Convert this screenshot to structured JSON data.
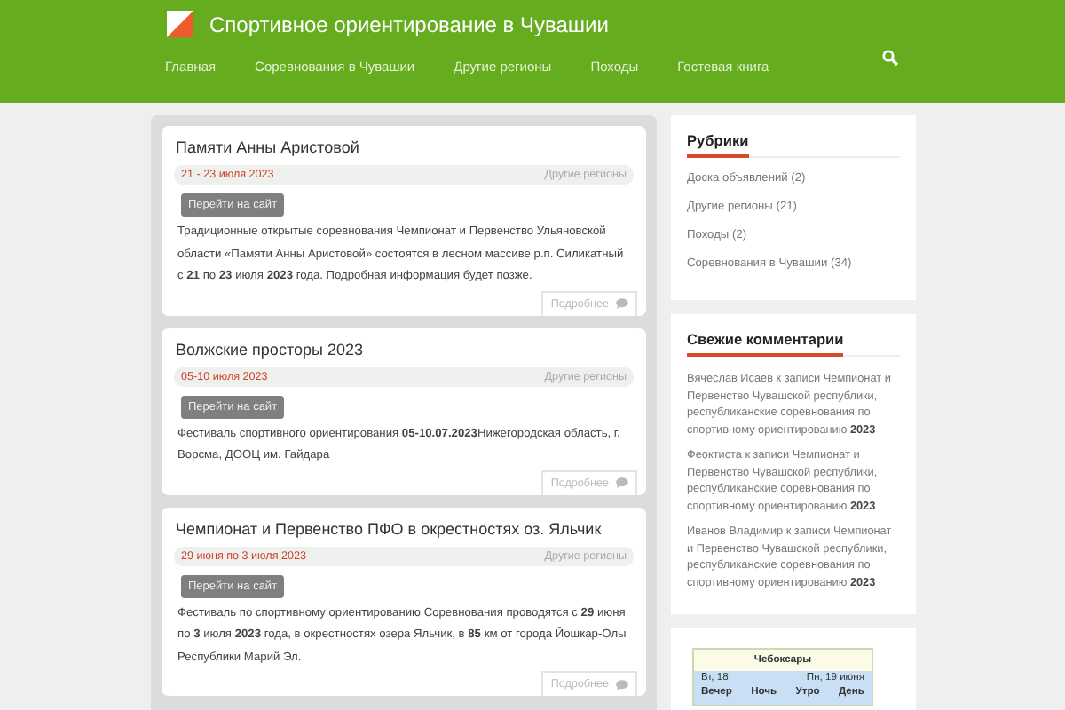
{
  "site": {
    "title": "Спортивное ориентирование в Чувашии"
  },
  "nav": [
    {
      "label": "Главная"
    },
    {
      "label": "Соревнования в Чувашии"
    },
    {
      "label": "Другие регионы"
    },
    {
      "label": "Походы"
    },
    {
      "label": "Гостевая книга"
    }
  ],
  "posts": [
    {
      "title": "Памяти Анны Аристовой",
      "date": "21 - 23 июля 2023",
      "category": "Другие регионы",
      "button": "Перейти на сайт",
      "text": "Традиционные открытые соревнования Чемпионат и Первенство Ульяновской области «Памяти Анны Аристовой» состоятся в лесном массиве р.п. Силикатный с **21** по **23** июля **2023** года. Подробная информация будет позже.",
      "more": "Подробнее"
    },
    {
      "title": "Волжские просторы 2023",
      "date": "05-10 июля 2023",
      "category": "Другие регионы",
      "button": "Перейти на сайт",
      "text": "Фестиваль спортивного ориентирования **05-10.07.2023**Нижегородская область, г. Ворсма, ДООЦ им. Гайдара",
      "more": "Подробнее"
    },
    {
      "title": "Чемпионат и Первенство ПФО в окрестностях оз. Яльчик",
      "date": "29 июня по 3 июля 2023",
      "category": "Другие регионы",
      "button": "Перейти на сайт",
      "text": "Фестиваль по спортивному ориентированию Соревнования проводятся с **29** июня по **3** июля **2023** года, в окрестностях озера Яльчик, в **85** км от города Йошкар-Олы Республики Марий Эл.",
      "more": "Подробнее"
    }
  ],
  "sidebar": {
    "categories": {
      "title": "Рубрики",
      "items": [
        {
          "label": "Доска объявлений",
          "count": "(2)"
        },
        {
          "label": "Другие регионы",
          "count": "(21)"
        },
        {
          "label": "Походы",
          "count": "(2)"
        },
        {
          "label": "Соревнования в Чувашии",
          "count": "(34)"
        }
      ]
    },
    "comments": {
      "title": "Свежие комментарии",
      "items": [
        "Вячеслав Исаев к записи Чемпионат и Первенство Чувашской республики, республиканские соревнования по спортивному ориентированию **2023**",
        "Феоктиста к записи Чемпионат и Первенство Чувашской республики, республиканские соревнования по спортивному ориентированию **2023**",
        "Иванов Владимир к записи Чемпионат и Первенство Чувашской республики, республиканские соревнования по спортивному ориентированию **2023**"
      ]
    },
    "weather": {
      "city": "Чебоксары",
      "day_1": "Вт, 18",
      "day_2": "Пн, 19 июня",
      "periods": [
        "Вечер",
        "Ночь",
        "Утро",
        "День"
      ]
    }
  }
}
